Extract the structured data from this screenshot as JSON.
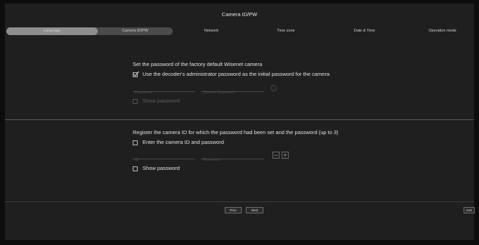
{
  "title": "Camera ID/PW",
  "steps": {
    "language": "Language",
    "camera_idpw": "Camera ID/PW",
    "network": "Network",
    "time_zone": "Time zone",
    "date_time": "Date & Time",
    "operation_mode": "Operation mode"
  },
  "password_section": {
    "heading": "Set the password of the factory default Wisenet camera",
    "use_decoder_label": "Use the decoder's administrator password as the initial password for the camera",
    "use_decoder_checked": true,
    "password_placeholder": "Password",
    "confirm_placeholder": "Confirm Password",
    "info_icon": "i",
    "show_password_label": "Show password"
  },
  "register_section": {
    "heading": "Register the camera ID for which the password had been set and the password (up to 3)",
    "enter_label": "Enter the camera ID and password",
    "id_placeholder": "ID",
    "password_placeholder": "Password",
    "minus_label": "−",
    "plus_label": "+",
    "show_password_label": "Show password"
  },
  "buttons": {
    "prev": "Prev",
    "next": "Next",
    "exit": "Exit"
  },
  "colors": {
    "background": "#1f1f1f",
    "step_completed": "#8e8e8e",
    "step_current": "#4b4b4b"
  }
}
